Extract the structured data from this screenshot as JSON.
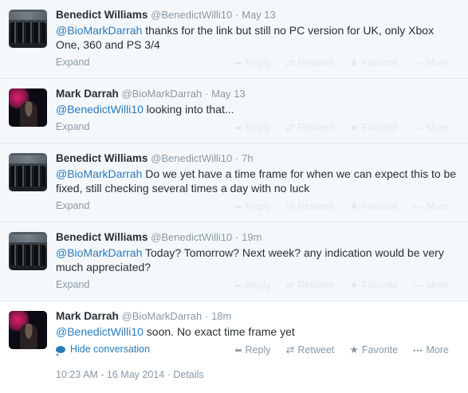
{
  "actions": {
    "reply": "Reply",
    "retweet": "Retweet",
    "favorite": "Favorite",
    "more": "More"
  },
  "tweets": [
    {
      "name": "Benedict Williams",
      "handle": "@BenedictWilli10",
      "sep": "·",
      "time": "May 13",
      "mention": "@BioMarkDarrah",
      "text": " thanks for the link but still no PC version for UK, only Xbox One, 360 and PS 3/4",
      "expand": "Expand"
    },
    {
      "name": "Mark Darrah",
      "handle": "@BioMarkDarrah",
      "sep": "·",
      "time": "May 13",
      "mention": "@BenedictWilli10",
      "text": " looking into that...",
      "expand": "Expand"
    },
    {
      "name": "Benedict Williams",
      "handle": "@BenedictWilli10",
      "sep": "·",
      "time": "7h",
      "mention": "@BioMarkDarrah",
      "text": " Do we yet have a time frame for when we can expect this to be fixed, still checking several times a day with no luck",
      "expand": "Expand"
    },
    {
      "name": "Benedict Williams",
      "handle": "@BenedictWilli10",
      "sep": "·",
      "time": "19m",
      "mention": "@BioMarkDarrah",
      "text": " Today? Tomorrow? Next week? any indication would be very much appreciated?",
      "expand": "Expand"
    },
    {
      "name": "Mark Darrah",
      "handle": "@BioMarkDarrah",
      "sep": "·",
      "time": "18m",
      "mention": "@BenedictWilli10",
      "text": " soon. No exact time frame yet",
      "hide_conversation": "Hide conversation"
    }
  ],
  "footer": {
    "timestamp": "10:23 AM - 16 May 2014",
    "sep": "·",
    "details": "Details"
  }
}
